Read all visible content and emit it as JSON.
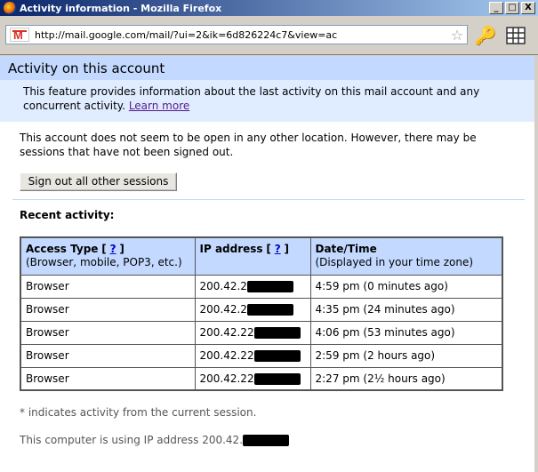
{
  "window": {
    "title": "Activity information - Mozilla Firefox",
    "buttons": {
      "minimize": "_",
      "maximize": "□",
      "close": "X"
    }
  },
  "nav": {
    "url": "http://mail.google.com/mail/?ui=2&ik=6d826224c7&view=ac",
    "gmail_glyph": "M",
    "star_glyph": "☆",
    "key_glyph": "🔑"
  },
  "page": {
    "title": "Activity on this account",
    "description": "This feature provides information about the last activity on this mail account and any concurrent activity. ",
    "learn_more": "Learn more",
    "notice": "This account does not seem to be open in any other location. However, there may be sessions that have not been signed out.",
    "signout_button": "Sign out all other sessions",
    "recent_label": "Recent activity:",
    "table": {
      "headers": [
        {
          "title": "Access Type",
          "help": "?",
          "sub": "(Browser, mobile, POP3, etc.)"
        },
        {
          "title": "IP address",
          "help": "?",
          "sub": ""
        },
        {
          "title": "Date/Time",
          "help": "",
          "sub": "(Displayed in your time zone)"
        }
      ],
      "rows": [
        {
          "type": "Browser",
          "ip": "200.42.2",
          "time": "4:59 pm (0 minutes ago)"
        },
        {
          "type": "Browser",
          "ip": "200.42.2",
          "time": "4:35 pm (24 minutes ago)"
        },
        {
          "type": "Browser",
          "ip": "200.42.22",
          "time": "4:06 pm (53 minutes ago)"
        },
        {
          "type": "Browser",
          "ip": "200.42.22",
          "time": "2:59 pm (2 hours ago)"
        },
        {
          "type": "Browser",
          "ip": "200.42.22",
          "time": "2:27 pm (2½ hours ago)"
        }
      ]
    },
    "footnote": "* indicates activity from the current session.",
    "ip_line": "This computer is using IP address 200.42."
  }
}
